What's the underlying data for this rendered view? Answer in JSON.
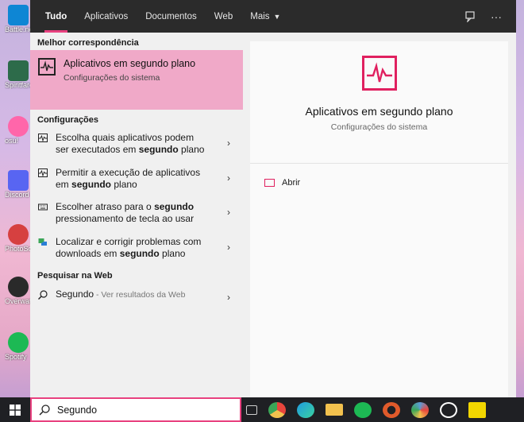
{
  "desktop": {
    "icons": [
      {
        "label": "Battle.net",
        "icon": "battlenet-icon",
        "color": "#0e86d4"
      },
      {
        "label": "Spiritfarer",
        "icon": "spiritfarer-icon",
        "color": "#2d6b4a"
      },
      {
        "label": "osu!",
        "icon": "osu-icon",
        "color": "#ff66aa"
      },
      {
        "label": "Discord",
        "icon": "discord-icon",
        "color": "#5865f2"
      },
      {
        "label": "PhotoScape",
        "icon": "photoscape-icon",
        "color": "#d64040"
      },
      {
        "label": "Overwatch",
        "icon": "overwatch-icon",
        "color": "#2a2a2a"
      },
      {
        "label": "Spotify",
        "icon": "spotify-icon",
        "color": "#1db954"
      }
    ]
  },
  "tabs": [
    {
      "label": "Tudo",
      "active": true
    },
    {
      "label": "Aplicativos"
    },
    {
      "label": "Documentos"
    },
    {
      "label": "Web"
    },
    {
      "label": "Mais"
    }
  ],
  "topright": {
    "feedback_icon": "feedback-icon",
    "more_icon": "more-options-icon",
    "more_glyph": "···"
  },
  "best_match": {
    "section": "Melhor correspondência",
    "title": "Aplicativos em segundo plano",
    "subtitle": "Configurações do sistema"
  },
  "settings": {
    "section": "Configurações",
    "items": [
      {
        "pre": "Escolha quais aplicativos podem ser executados em ",
        "bold": "segundo",
        "post": " plano",
        "icon": "background-apps-icon"
      },
      {
        "pre": "Permitir a execução de aplicativos em ",
        "bold": "segundo",
        "post": " plano",
        "icon": "background-apps-icon"
      },
      {
        "pre": "Escolher atraso para o ",
        "bold": "segundo",
        "post": " pressionamento de tecla ao usar",
        "icon": "keyboard-icon"
      },
      {
        "pre": "Localizar e corrigir problemas com downloads em ",
        "bold": "segundo",
        "post": " plano",
        "icon": "troubleshoot-icon"
      }
    ]
  },
  "web": {
    "section": "Pesquisar na Web",
    "query": "Segundo",
    "suffix": " - Ver resultados da Web"
  },
  "detail": {
    "title": "Aplicativos em segundo plano",
    "subtitle": "Configurações do sistema",
    "action_label": "Abrir"
  },
  "taskbar": {
    "search_value": "Segundo",
    "apps": [
      {
        "icon": "task-view-icon",
        "color": "#d0d0d0"
      },
      {
        "icon": "chrome-icon",
        "color": "#e8453c"
      },
      {
        "icon": "edge-icon",
        "color": "#1f9be0"
      },
      {
        "icon": "file-explorer-icon",
        "color": "#f2c14e"
      },
      {
        "icon": "spotify-icon",
        "color": "#1db954"
      },
      {
        "icon": "steelseries-icon",
        "color": "#e05a2b"
      },
      {
        "icon": "paint-icon",
        "color": "#5b9bd5"
      },
      {
        "icon": "app-icon",
        "color": "#ffffff"
      },
      {
        "icon": "sticky-notes-icon",
        "color": "#f2d600"
      }
    ]
  },
  "colors": {
    "accent": "#e8417f",
    "highlight": "#f0a9c8",
    "brand_icon": "#e0205f"
  }
}
